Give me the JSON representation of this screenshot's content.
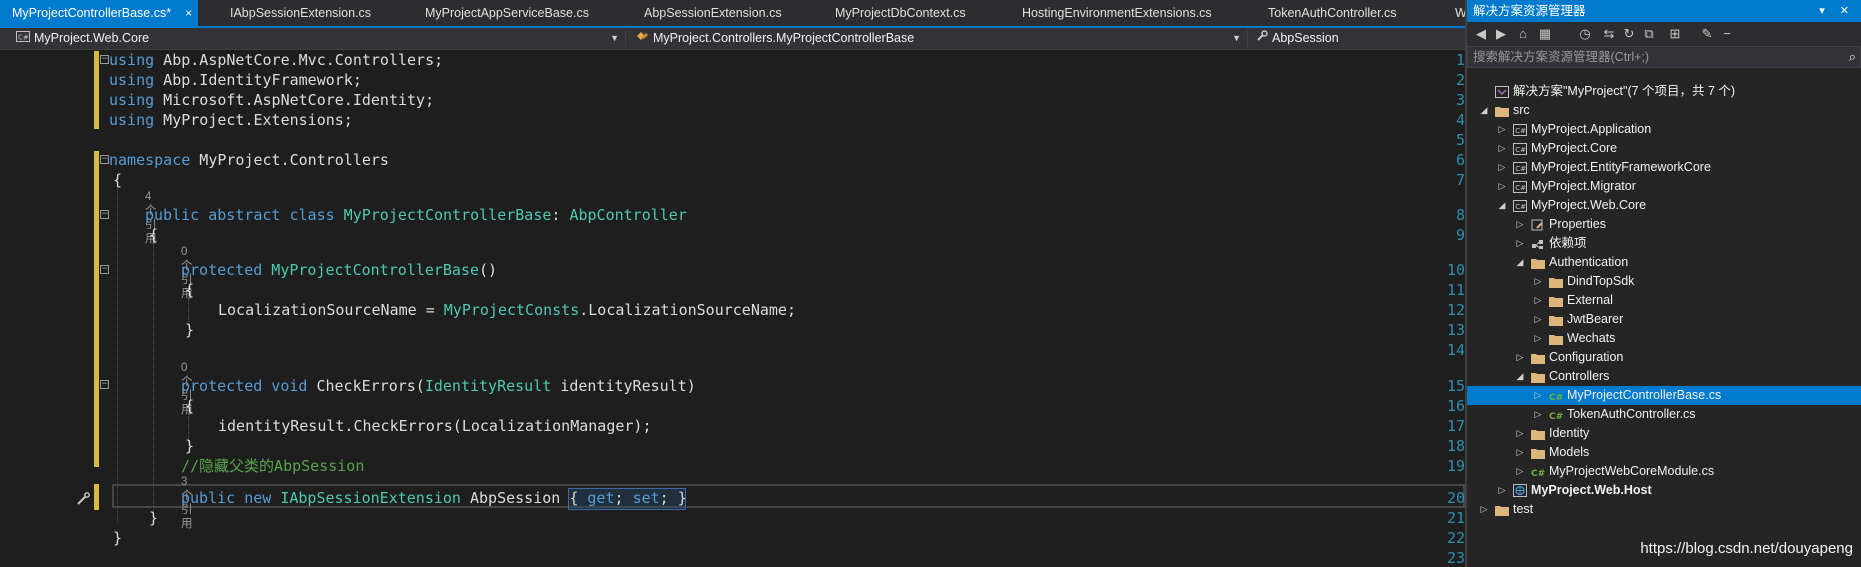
{
  "tabs": [
    {
      "label": "MyProjectControllerBase.cs*",
      "active": true
    },
    {
      "label": "IAbpSessionExtension.cs"
    },
    {
      "label": "MyProjectAppServiceBase.cs"
    },
    {
      "label": "AbpSessionExtension.cs"
    },
    {
      "label": "MyProjectDbContext.cs"
    },
    {
      "label": "HostingEnvironmentExtensions.cs"
    },
    {
      "label": "TokenAuthController.cs"
    },
    {
      "label": "W"
    }
  ],
  "tab_close_glyph": "×",
  "navbar": {
    "project": "MyProject.Web.Core",
    "class": "MyProject.Controllers.MyProjectControllerBase",
    "member": "AbpSession"
  },
  "line_numbers": [
    "1",
    "2",
    "3",
    "4",
    "5",
    "6",
    "7",
    "8",
    "9",
    "10",
    "11",
    "12",
    "13",
    "14",
    "15",
    "16",
    "17",
    "18",
    "19",
    "20",
    "21",
    "22",
    "23"
  ],
  "code": {
    "l1": {
      "kw": "using",
      "rest": " Abp.AspNetCore.Mvc.Controllers;"
    },
    "l2": {
      "kw": "using",
      "rest": " Abp.IdentityFramework;"
    },
    "l3": {
      "kw": "using",
      "rest": " Microsoft.AspNetCore.Identity;"
    },
    "l4": {
      "kw": "using",
      "rest": " MyProject.Extensions;"
    },
    "l6": {
      "kw": "namespace",
      "rest": " MyProject.Controllers"
    },
    "l7": "{",
    "lens8": "4 个引用",
    "l8": {
      "kw": "public abstract class",
      "name": " MyProjectControllerBase",
      "colon": ": ",
      "base": "AbpController"
    },
    "l9": "{",
    "lens10": "0 个引用",
    "l10": {
      "kw": "protected",
      "name": " MyProjectControllerBase",
      "rest": "()"
    },
    "l11": "{",
    "l12": {
      "a": "LocalizationSourceName = ",
      "ty": "MyProjectConsts",
      "b": ".LocalizationSourceName;"
    },
    "l13": "}",
    "lens15": "0 个引用",
    "l15": {
      "kw": "protected void",
      "a": " CheckErrors(",
      "ty": "IdentityResult",
      "b": " identityResult)"
    },
    "l16": "{",
    "l17": "identityResult.CheckErrors(LocalizationManager);",
    "l18": "}",
    "l19": "//隐藏父类的AbpSession",
    "lens20": "3 个引用",
    "l20": {
      "kw": "public new",
      "ty": " IAbpSessionExtension",
      "a": " AbpSession ",
      "b": "{ ",
      "get": "get",
      "semi1": "; ",
      "set": "set",
      "semi2": "; ",
      "c": "}"
    },
    "l21": "}",
    "l22": "}"
  },
  "watermark": "https://blog.csdn.net/douyapeng",
  "solution_explorer": {
    "title": "解决方案资源管理器",
    "search_placeholder": "搜索解决方案资源管理器(Ctrl+;)",
    "tree": [
      {
        "label": "解决方案\"MyProject\"(7 个项目，共 7 个)",
        "depth": 0,
        "arrow": "",
        "icon": "solution"
      },
      {
        "label": "src",
        "depth": 0,
        "arrow": "open",
        "icon": "folder"
      },
      {
        "label": "MyProject.Application",
        "depth": 1,
        "arrow": "closed",
        "icon": "project"
      },
      {
        "label": "MyProject.Core",
        "depth": 1,
        "arrow": "closed",
        "icon": "project"
      },
      {
        "label": "MyProject.EntityFrameworkCore",
        "depth": 1,
        "arrow": "closed",
        "icon": "project"
      },
      {
        "label": "MyProject.Migrator",
        "depth": 1,
        "arrow": "closed",
        "icon": "project"
      },
      {
        "label": "MyProject.Web.Core",
        "depth": 1,
        "arrow": "open",
        "icon": "project"
      },
      {
        "label": "Properties",
        "depth": 2,
        "arrow": "closed",
        "icon": "properties"
      },
      {
        "label": "依赖项",
        "depth": 2,
        "arrow": "closed",
        "icon": "dependencies"
      },
      {
        "label": "Authentication",
        "depth": 2,
        "arrow": "open",
        "icon": "folder"
      },
      {
        "label": "DindTopSdk",
        "depth": 3,
        "arrow": "closed",
        "icon": "folder"
      },
      {
        "label": "External",
        "depth": 3,
        "arrow": "closed",
        "icon": "folder"
      },
      {
        "label": "JwtBearer",
        "depth": 3,
        "arrow": "closed",
        "icon": "folder"
      },
      {
        "label": "Wechats",
        "depth": 3,
        "arrow": "closed",
        "icon": "folder"
      },
      {
        "label": "Configuration",
        "depth": 2,
        "arrow": "closed",
        "icon": "folder"
      },
      {
        "label": "Controllers",
        "depth": 2,
        "arrow": "open",
        "icon": "folder"
      },
      {
        "label": "MyProjectControllerBase.cs",
        "depth": 3,
        "arrow": "closed",
        "icon": "csharp",
        "selected": true
      },
      {
        "label": "TokenAuthController.cs",
        "depth": 3,
        "arrow": "closed",
        "icon": "csharp"
      },
      {
        "label": "Identity",
        "depth": 2,
        "arrow": "closed",
        "icon": "folder"
      },
      {
        "label": "Models",
        "depth": 2,
        "arrow": "closed",
        "icon": "folder"
      },
      {
        "label": "MyProjectWebCoreModule.cs",
        "depth": 2,
        "arrow": "closed",
        "icon": "csharp"
      },
      {
        "label": "MyProject.Web.Host",
        "depth": 1,
        "arrow": "closed",
        "icon": "web-project",
        "bold": true
      },
      {
        "label": "test",
        "depth": 0,
        "arrow": "closed",
        "icon": "folder"
      }
    ]
  }
}
